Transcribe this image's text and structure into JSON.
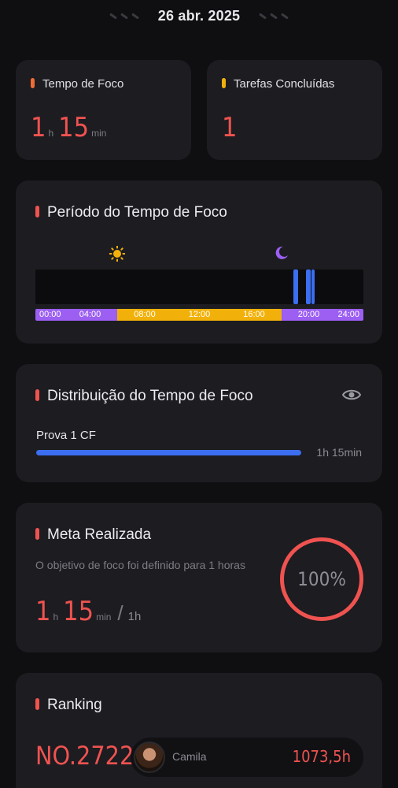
{
  "header": {
    "date": "26 abr. 2025"
  },
  "focus_time_card": {
    "title": "Tempo de Foco",
    "hours": "1",
    "hours_unit": "h",
    "minutes": "15",
    "minutes_unit": "min",
    "accent": "#ef6c35"
  },
  "tasks_card": {
    "title": "Tarefas Concluídas",
    "value": "1",
    "accent": "#f2b10a"
  },
  "period_card": {
    "title": "Período do Tempo de Foco",
    "day_icon": "sun-icon",
    "night_icon": "moon-icon",
    "ticks": [
      "00:00",
      "04:00",
      "08:00",
      "12:00",
      "16:00",
      "20:00",
      "24:00"
    ],
    "sessions_hours": [
      [
        18.9,
        19.3
      ],
      [
        19.8,
        20.2
      ],
      [
        20.2,
        20.5
      ]
    ]
  },
  "distribution_card": {
    "title": "Distribuição do Tempo de Foco",
    "toggle_icon": "eye-icon",
    "item_label": "Prova 1 CF",
    "item_value": "1h 15min",
    "item_fraction": 1.0
  },
  "goal_card": {
    "title": "Meta Realizada",
    "description": "O objetivo de foco foi definido para 1 horas",
    "hours": "1",
    "hours_unit": "h",
    "minutes": "15",
    "minutes_unit": "min",
    "separator": "/",
    "target": "1h",
    "percent_label": "100%"
  },
  "ranking_card": {
    "title": "Ranking",
    "position": "NO.27228",
    "user_name": "Camila",
    "user_hours": "1073,5h"
  },
  "colors": {
    "accent_red": "#ef5350",
    "blue": "#3b6ef0",
    "purple": "#9c5ff2",
    "yellow": "#f2b10a",
    "card": "#1c1c21",
    "bg": "#0f0f12"
  }
}
